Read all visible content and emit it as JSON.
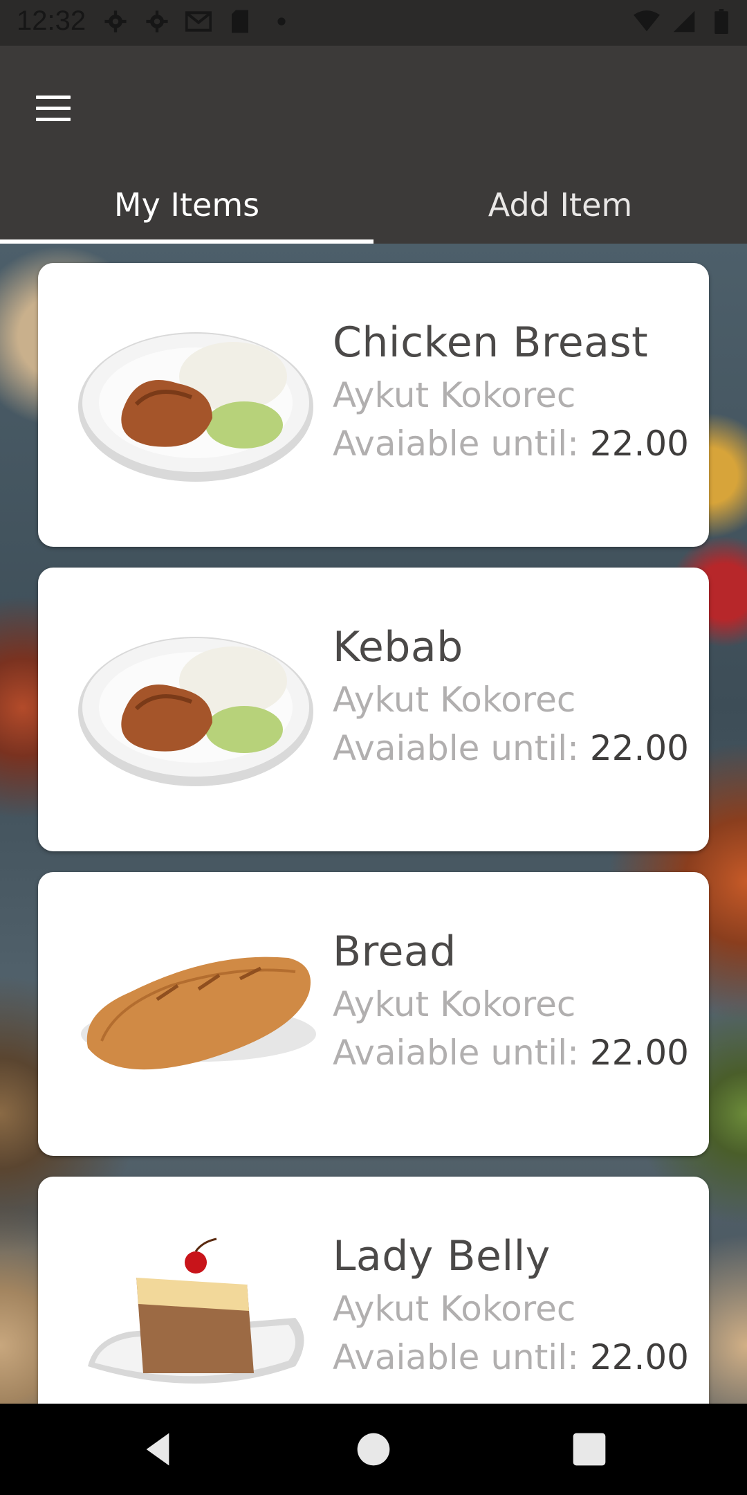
{
  "status_bar": {
    "time": "12:32",
    "left_icons": [
      "gear-icon",
      "gear-icon",
      "gmail-icon",
      "sd-card-icon",
      "dot-icon"
    ],
    "right_icons": [
      "wifi-icon",
      "signal-icon",
      "battery-icon"
    ]
  },
  "app_bar": {
    "menu_icon": "hamburger-menu-icon",
    "tabs": [
      {
        "label": "My Items",
        "active": true
      },
      {
        "label": "Add Item",
        "active": false
      }
    ]
  },
  "items": [
    {
      "name": "Chicken Breast",
      "owner": "Aykut Kokorec",
      "avail_label": "Avaiable until: ",
      "avail_value": "22.00",
      "image": "chicken-rice-plate"
    },
    {
      "name": "Kebab",
      "owner": "Aykut Kokorec",
      "avail_label": "Avaiable until: ",
      "avail_value": "22.00",
      "image": "chicken-rice-plate"
    },
    {
      "name": "Bread",
      "owner": "Aykut Kokorec",
      "avail_label": "Avaiable until: ",
      "avail_value": "22.00",
      "image": "bread-loaf"
    },
    {
      "name": "Lady Belly",
      "owner": "Aykut Kokorec",
      "avail_label": "Avaiable until: ",
      "avail_value": "22.00",
      "image": "cake-slice"
    }
  ],
  "nav_bar": {
    "buttons": [
      "back-icon",
      "home-icon",
      "recents-icon"
    ]
  },
  "colors": {
    "app_bar": "#3c3a39",
    "status_bar": "#2b2a29",
    "title_text": "#4b4948",
    "secondary_text": "#b1afaf"
  }
}
